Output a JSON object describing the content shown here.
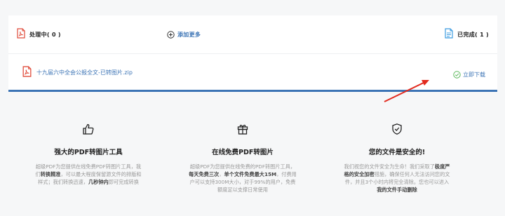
{
  "panel": {
    "processing_label": "处理中( 0 )",
    "add_more_label": "添加更多",
    "done_label": "已完成( 1 )",
    "file_name": "十九届六中全会公报全文-已转图片.zip",
    "download_label": "立即下载"
  },
  "features": [
    {
      "icon": "thumbs-up-icon",
      "title": "强大的PDF转图片工具",
      "desc": [
        [
          {
            "t": "超级PDF为您提供在线免费PDF转图片工具，我",
            "b": false
          }
        ],
        [
          {
            "t": "们",
            "b": false
          },
          {
            "t": "转换精准",
            "b": true
          },
          {
            "t": "，可以最大程度保留源文件的排版和",
            "b": false
          }
        ],
        [
          {
            "t": "样式；我们转换迅速，",
            "b": false
          },
          {
            "t": "几秒钟内",
            "b": true
          },
          {
            "t": "即可完成转换",
            "b": false
          }
        ]
      ]
    },
    {
      "icon": "gift-icon",
      "title": "在线免费PDF转图片",
      "desc": [
        [
          {
            "t": "超级PDF为您提供在线免费的PDF转图片工具，",
            "b": false
          }
        ],
        [
          {
            "t": "每天免费三次",
            "b": true
          },
          {
            "t": "，",
            "b": false
          },
          {
            "t": "单个文件免费最大15M",
            "b": true
          },
          {
            "t": "，付费用",
            "b": false
          }
        ],
        [
          {
            "t": "户可以支持300M大小，对于99%的用户，免费",
            "b": false
          }
        ],
        [
          {
            "t": "额度足以支撑日常使用",
            "b": false
          }
        ]
      ]
    },
    {
      "icon": "shield-check-icon",
      "title": "您的文件是安全的!",
      "desc": [
        [
          {
            "t": "我们视您的文件安全为生命！我们采取了",
            "b": false
          },
          {
            "t": "极度严",
            "b": true
          }
        ],
        [
          {
            "t": "格的安全加密",
            "b": true
          },
          {
            "t": "措施，确保任何人无法访问您的文",
            "b": false
          }
        ],
        [
          {
            "t": "件，并且3个小时内将完全清除。您也可以进入",
            "b": false
          }
        ],
        [
          {
            "t": "我的文件手动删除",
            "b": true
          }
        ]
      ]
    }
  ]
}
